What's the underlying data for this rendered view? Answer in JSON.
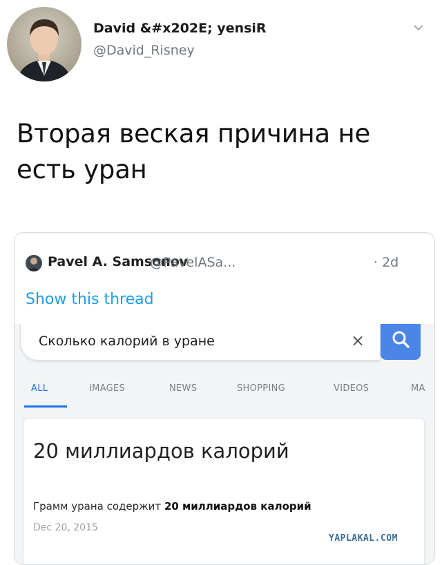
{
  "tweet": {
    "author_name": "David &#x202E; yensiR",
    "author_handle": "@David_Risney",
    "text": "Вторая веская причина не есть уран",
    "avatar_icon": "profile-photo-avatar",
    "menu_icon": "chevron-down-icon"
  },
  "quoted_tweet": {
    "author_name": "Pavel A. Samsonov",
    "author_handle": "@PavelASa...",
    "time": "· 2d",
    "show_thread": "Show this thread",
    "link_color": "#1d9bf0"
  },
  "search": {
    "query": "Сколько калорий в уране",
    "clear_icon": "×",
    "button_color": "#4a86e8",
    "tabs": [
      {
        "label": "ALL",
        "active": true
      },
      {
        "label": "IMAGES",
        "active": false
      },
      {
        "label": "NEWS",
        "active": false
      },
      {
        "label": "SHOPPING",
        "active": false
      },
      {
        "label": "VIDEOS",
        "active": false
      },
      {
        "label": "MA",
        "active": false
      }
    ],
    "accent_color": "#1a73e8"
  },
  "result": {
    "title": "20 миллиардов калорий",
    "snippet_prefix": "Грамм урана содержит ",
    "snippet_bold": "20 миллиардов калорий",
    "date": "Dec 20, 2015"
  },
  "watermark": "YAPLAKAL.COM"
}
